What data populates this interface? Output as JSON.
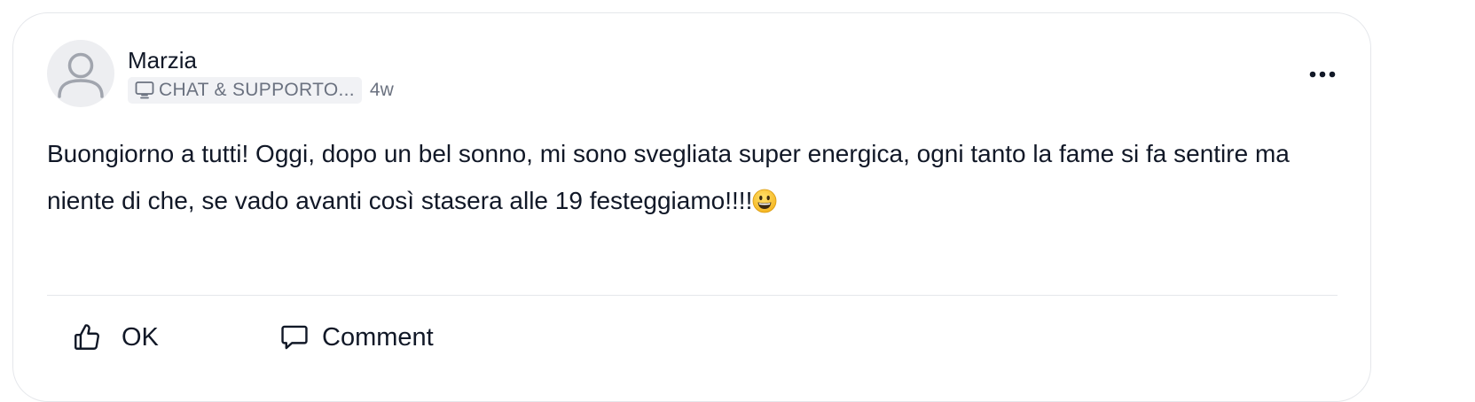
{
  "post": {
    "author": "Marzia",
    "group_label": "CHAT & SUPPORTO...",
    "time_ago": "4w",
    "text": "Buongiorno a tutti! Oggi, dopo un bel sonno, mi sono svegliata super energica, ogni tanto la fame si fa sentire ma niente di che, se vado avanti così stasera alle 19 festeggiamo!!!!",
    "emoji": "grinning-face"
  },
  "actions": {
    "like_label": "OK",
    "comment_label": "Comment"
  },
  "icons": {
    "avatar": "user-placeholder-icon",
    "group": "monitor-icon",
    "menu": "more-horizontal-icon",
    "like": "thumbs-up-icon",
    "comment": "comment-bubble-icon"
  },
  "colors": {
    "text": "#111827",
    "muted": "#6b7280",
    "chip_bg": "#f1f2f5",
    "border": "#e5e7eb"
  }
}
